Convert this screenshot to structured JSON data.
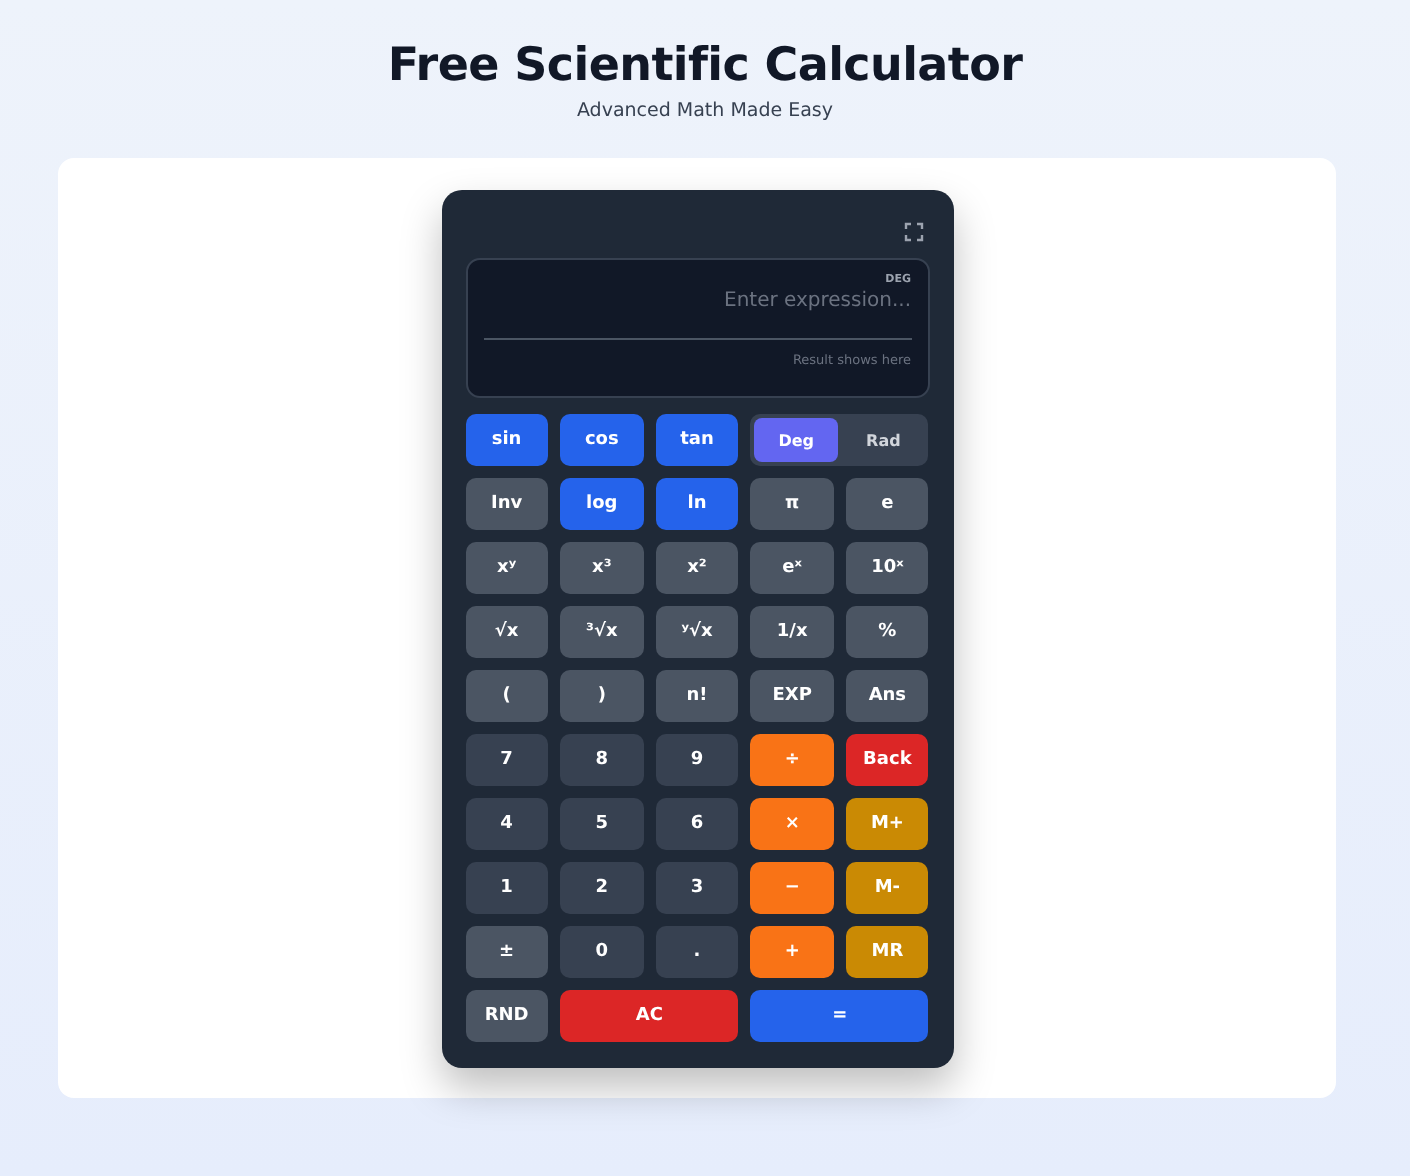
{
  "header": {
    "title": "Free Scientific Calculator",
    "subtitle": "Advanced Math Made Easy"
  },
  "display": {
    "mode": "DEG",
    "placeholder": "Enter expression...",
    "result": "Result shows here"
  },
  "keys": [
    {
      "label": "sin",
      "kind": "func"
    },
    {
      "label": "cos",
      "kind": "func"
    },
    {
      "label": "tan",
      "kind": "func"
    },
    {
      "kind": "toggle",
      "options": [
        {
          "label": "Deg",
          "selected": true
        },
        {
          "label": "Rad",
          "selected": false
        }
      ]
    },
    {
      "label": "Inv",
      "kind": "fn2"
    },
    {
      "label": "log",
      "kind": "func"
    },
    {
      "label": "ln",
      "kind": "func"
    },
    {
      "label": "π",
      "kind": "fn2"
    },
    {
      "label": "e",
      "kind": "fn2"
    },
    {
      "label": "xʸ",
      "kind": "fn2"
    },
    {
      "label": "x³",
      "kind": "fn2"
    },
    {
      "label": "x²",
      "kind": "fn2"
    },
    {
      "label": "eˣ",
      "kind": "fn2"
    },
    {
      "label": "10ˣ",
      "kind": "fn2"
    },
    {
      "label": "√x",
      "kind": "fn2"
    },
    {
      "label": "³√x",
      "kind": "fn2"
    },
    {
      "label": "ʸ√x",
      "kind": "fn2"
    },
    {
      "label": "1/x",
      "kind": "fn2"
    },
    {
      "label": "%",
      "kind": "fn2"
    },
    {
      "label": "(",
      "kind": "fn2"
    },
    {
      "label": ")",
      "kind": "fn2"
    },
    {
      "label": "n!",
      "kind": "fn2"
    },
    {
      "label": "EXP",
      "kind": "fn2"
    },
    {
      "label": "Ans",
      "kind": "fn2"
    },
    {
      "label": "7",
      "kind": "num"
    },
    {
      "label": "8",
      "kind": "num"
    },
    {
      "label": "9",
      "kind": "num"
    },
    {
      "label": "÷",
      "kind": "op"
    },
    {
      "label": "Back",
      "kind": "del"
    },
    {
      "label": "4",
      "kind": "num"
    },
    {
      "label": "5",
      "kind": "num"
    },
    {
      "label": "6",
      "kind": "num"
    },
    {
      "label": "×",
      "kind": "op"
    },
    {
      "label": "M+",
      "kind": "mem"
    },
    {
      "label": "1",
      "kind": "num"
    },
    {
      "label": "2",
      "kind": "num"
    },
    {
      "label": "3",
      "kind": "num"
    },
    {
      "label": "−",
      "kind": "op"
    },
    {
      "label": "M-",
      "kind": "mem"
    },
    {
      "label": "±",
      "kind": "fn2"
    },
    {
      "label": "0",
      "kind": "num"
    },
    {
      "label": ".",
      "kind": "num"
    },
    {
      "label": "+",
      "kind": "op"
    },
    {
      "label": "MR",
      "kind": "mem"
    },
    {
      "label": "RND",
      "kind": "fn2"
    },
    {
      "label": "AC",
      "kind": "clear"
    },
    {
      "label": "=",
      "kind": "equals"
    }
  ]
}
